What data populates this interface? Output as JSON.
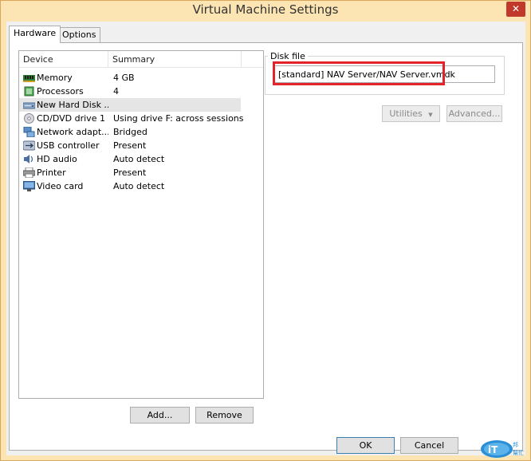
{
  "window": {
    "title": "Virtual Machine Settings",
    "close_label": "✕"
  },
  "tabs": [
    {
      "label": "Hardware",
      "active": true
    },
    {
      "label": "Options",
      "active": false
    }
  ],
  "device_list": {
    "col_device": "Device",
    "col_summary": "Summary",
    "rows": [
      {
        "name": "Memory",
        "summary": "4 GB",
        "icon": "memory-icon"
      },
      {
        "name": "Processors",
        "summary": "4",
        "icon": "processor-icon"
      },
      {
        "name": "New Hard Disk ...",
        "summary": "",
        "icon": "hard-disk-icon",
        "selected": true
      },
      {
        "name": "CD/DVD drive 1",
        "summary": "Using drive F: across sessions",
        "icon": "cd-dvd-icon"
      },
      {
        "name": "Network adapt...",
        "summary": "Bridged",
        "icon": "network-adapter-icon"
      },
      {
        "name": "USB controller",
        "summary": "Present",
        "icon": "usb-icon"
      },
      {
        "name": "HD audio",
        "summary": "Auto detect",
        "icon": "speaker-icon"
      },
      {
        "name": "Printer",
        "summary": "Present",
        "icon": "printer-icon"
      },
      {
        "name": "Video card",
        "summary": "Auto detect",
        "icon": "monitor-icon"
      }
    ]
  },
  "list_buttons": {
    "add": "Add...",
    "remove": "Remove"
  },
  "disk_file": {
    "group_label": "Disk file",
    "value": "[standard] NAV Server/NAV Server.vmdk"
  },
  "disk_buttons": {
    "utilities": "Utilities",
    "utilities_arrow": "▼",
    "advanced": "Advanced..."
  },
  "footer": {
    "ok": "OK",
    "cancel": "Cancel"
  },
  "colors": {
    "titlebar": "#fce4b3",
    "close": "#c0392b",
    "highlight_box": "#e3232a",
    "selection": "#e5e5e5"
  }
}
